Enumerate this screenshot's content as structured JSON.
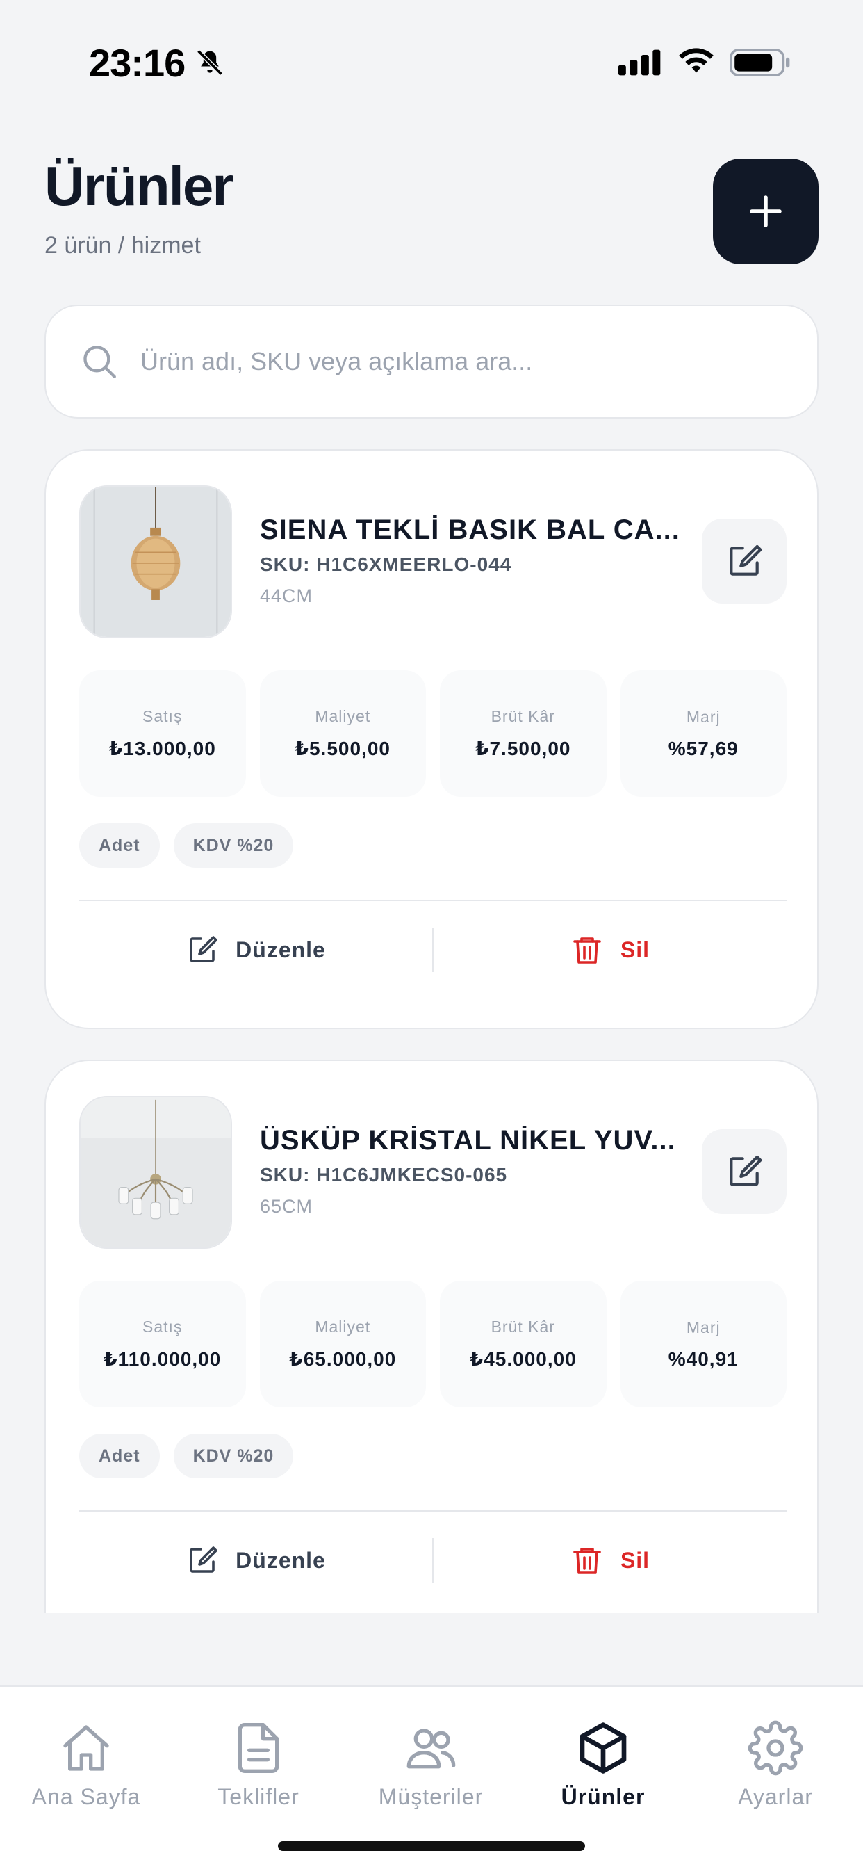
{
  "status_bar": {
    "time": "23:16"
  },
  "header": {
    "title": "Ürünler",
    "subtitle": "2 ürün / hizmet"
  },
  "search": {
    "placeholder": "Ürün adı, SKU veya açıklama ara..."
  },
  "products": [
    {
      "name": "SIENA TEKLİ BASIK BAL CA...",
      "sku": "SKU: H1C6XMEERLO-044",
      "description": "44CM",
      "stats": [
        {
          "label": "Satış",
          "value": "₺13.000,00"
        },
        {
          "label": "Maliyet",
          "value": "₺5.500,00"
        },
        {
          "label": "Brüt Kâr",
          "value": "₺7.500,00"
        },
        {
          "label": "Marj",
          "value": "%57,69"
        }
      ],
      "tags": [
        "Adet",
        "KDV %20"
      ],
      "edit_label": "Düzenle",
      "delete_label": "Sil"
    },
    {
      "name": "ÜSKÜP KRİSTAL NİKEL YUV...",
      "sku": "SKU: H1C6JMKECS0-065",
      "description": "65CM",
      "stats": [
        {
          "label": "Satış",
          "value": "₺110.000,00"
        },
        {
          "label": "Maliyet",
          "value": "₺65.000,00"
        },
        {
          "label": "Brüt Kâr",
          "value": "₺45.000,00"
        },
        {
          "label": "Marj",
          "value": "%40,91"
        }
      ],
      "tags": [
        "Adet",
        "KDV %20"
      ],
      "edit_label": "Düzenle",
      "delete_label": "Sil"
    }
  ],
  "tabbar": {
    "items": [
      {
        "label": "Ana Sayfa",
        "icon": "home-icon",
        "active": false
      },
      {
        "label": "Teklifler",
        "icon": "document-icon",
        "active": false
      },
      {
        "label": "Müşteriler",
        "icon": "users-icon",
        "active": false
      },
      {
        "label": "Ürünler",
        "icon": "box-icon",
        "active": true
      },
      {
        "label": "Ayarlar",
        "icon": "gear-icon",
        "active": false
      }
    ]
  },
  "colors": {
    "primary": "#111827",
    "danger": "#dc2626",
    "muted": "#9ca3af",
    "background": "#f3f4f6"
  }
}
